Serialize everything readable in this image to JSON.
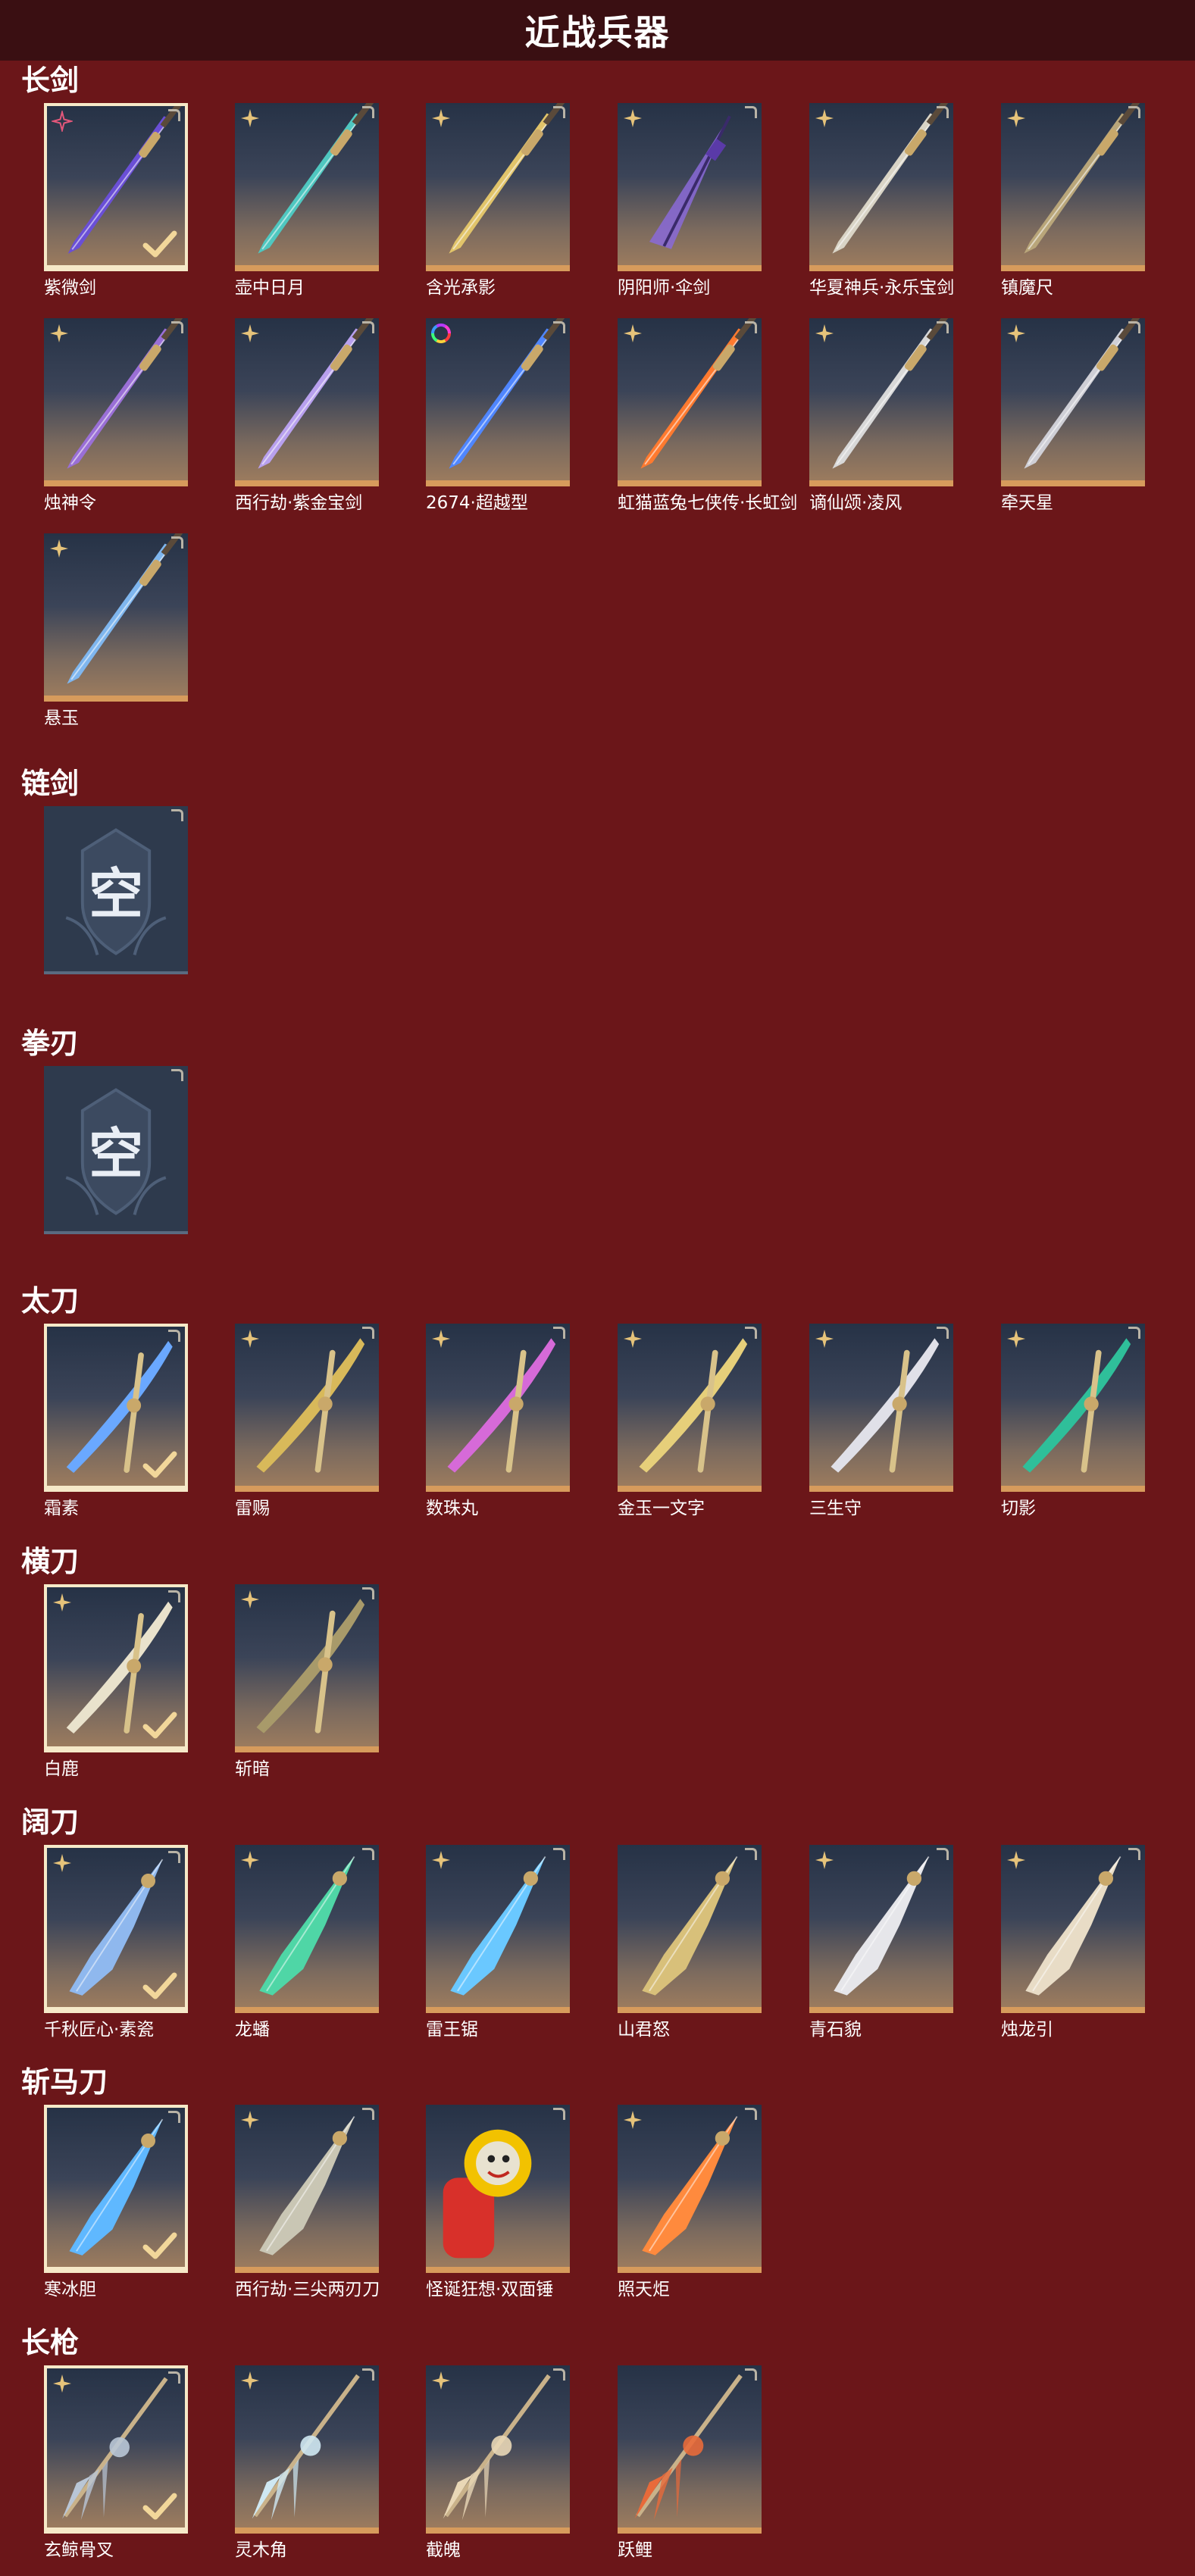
{
  "page": {
    "title": "近战兵器"
  },
  "colors": {
    "background": "#6b1619",
    "header": "#3a0f12",
    "card_accent": "#d79b5c",
    "selected_border": "#f6e9c8",
    "star_badge": "#e6c37a"
  },
  "check_icon": "checkmark-icon",
  "empty_label": "空",
  "sections": [
    {
      "key": "changjian",
      "title": "长剑",
      "items": [
        {
          "label": "紫微剑",
          "selected": true,
          "badge": "pink-star-icon",
          "hue": "#6a4fd6",
          "shape": "sword"
        },
        {
          "label": "壶中日月",
          "selected": false,
          "badge": "gold-star-icon",
          "hue": "#4fc7c0",
          "shape": "sword"
        },
        {
          "label": "含光承影",
          "selected": false,
          "badge": "gold-star-icon",
          "hue": "#e1c46a",
          "shape": "sword"
        },
        {
          "label": "阴阳师·伞剑",
          "selected": false,
          "badge": "gold-star-icon",
          "hue": "#8a6ad8",
          "shape": "umbrella"
        },
        {
          "label": "华夏神兵·永乐宝剑",
          "selected": false,
          "badge": "gold-star-icon",
          "hue": "#d9d4c6",
          "shape": "sword"
        },
        {
          "label": "镇魔尺",
          "selected": false,
          "badge": "gold-star-icon",
          "hue": "#b9a67a",
          "shape": "sword"
        },
        {
          "label": "烛神令",
          "selected": false,
          "badge": "gold-star-icon",
          "hue": "#9a6fd6",
          "shape": "sword"
        },
        {
          "label": "西行劫·紫金宝剑",
          "selected": false,
          "badge": "gold-star-icon",
          "hue": "#b8a0ee",
          "shape": "sword"
        },
        {
          "label": "2674·超越型",
          "selected": false,
          "badge": "rainbow-ring-icon",
          "hue": "#4f86ff",
          "shape": "sword"
        },
        {
          "label": "虹猫蓝兔七侠传·长虹剑",
          "selected": false,
          "badge": "gold-star-icon",
          "hue": "#ff7a2f",
          "shape": "sword"
        },
        {
          "label": "谪仙颂·凌风",
          "selected": false,
          "badge": "gold-star-icon",
          "hue": "#d8d8d8",
          "shape": "sword"
        },
        {
          "label": "牵天星",
          "selected": false,
          "badge": "gold-star-icon",
          "hue": "#cfcfd6",
          "shape": "sword"
        },
        {
          "label": "悬玉",
          "selected": false,
          "badge": "gold-star-icon",
          "hue": "#7fb6ee",
          "shape": "sword",
          "stacked": true
        }
      ]
    },
    {
      "key": "lianjian",
      "title": "链剑",
      "items": [
        {
          "label": "",
          "empty": true
        }
      ]
    },
    {
      "key": "quanren",
      "title": "拳刃",
      "items": [
        {
          "label": "",
          "empty": true
        }
      ]
    },
    {
      "key": "taidao",
      "title": "太刀",
      "items": [
        {
          "label": "霜素",
          "selected": true,
          "badge": "",
          "hue": "#6aa8ff",
          "shape": "blade"
        },
        {
          "label": "雷赐",
          "selected": false,
          "badge": "gold-star-icon",
          "hue": "#d8b95a",
          "shape": "blade"
        },
        {
          "label": "数珠丸",
          "selected": false,
          "badge": "gold-star-icon",
          "hue": "#d66ad8",
          "shape": "blade"
        },
        {
          "label": "金玉一文字",
          "selected": false,
          "badge": "gold-star-icon",
          "hue": "#e6cf7a",
          "shape": "blade"
        },
        {
          "label": "三生守",
          "selected": false,
          "badge": "gold-star-icon",
          "hue": "#e0e0e8",
          "shape": "blade"
        },
        {
          "label": "切影",
          "selected": false,
          "badge": "gold-star-icon",
          "hue": "#2fbf9a",
          "shape": "blade"
        }
      ]
    },
    {
      "key": "hengdao",
      "title": "横刀",
      "items": [
        {
          "label": "白鹿",
          "selected": true,
          "badge": "gold-star-icon",
          "hue": "#e9e2cc",
          "shape": "blade"
        },
        {
          "label": "斩暗",
          "selected": false,
          "badge": "gold-star-icon",
          "hue": "#a89a6a",
          "shape": "blade"
        }
      ]
    },
    {
      "key": "kuodao",
      "title": "阔刀",
      "items": [
        {
          "label": "千秋匠心·素瓷",
          "selected": true,
          "badge": "gold-star-icon",
          "hue": "#8fb8ee",
          "shape": "broad"
        },
        {
          "label": "龙蟠",
          "selected": false,
          "badge": "gold-star-icon",
          "hue": "#4fd6a6",
          "shape": "broad"
        },
        {
          "label": "雷王锯",
          "selected": false,
          "badge": "gold-star-icon",
          "hue": "#6ac8ff",
          "shape": "broad"
        },
        {
          "label": "山君怒",
          "selected": false,
          "badge": "",
          "hue": "#d8c07a",
          "shape": "broad"
        },
        {
          "label": "青石貌",
          "selected": false,
          "badge": "gold-star-icon",
          "hue": "#e6e6ea",
          "shape": "broad"
        },
        {
          "label": "烛龙引",
          "selected": false,
          "badge": "gold-star-icon",
          "hue": "#e8dcc6",
          "shape": "broad"
        }
      ]
    },
    {
      "key": "zhanmadao",
      "title": "斩马刀",
      "items": [
        {
          "label": "寒冰胆",
          "selected": true,
          "badge": "",
          "hue": "#5fb8ff",
          "shape": "broad"
        },
        {
          "label": "西行劫·三尖两刃刀",
          "selected": false,
          "badge": "gold-star-icon",
          "hue": "#c9c6b4",
          "shape": "broad"
        },
        {
          "label": "怪诞狂想·双面锤",
          "selected": false,
          "badge": "",
          "hue": "#f2c200",
          "shape": "hammer"
        },
        {
          "label": "照天炬",
          "selected": false,
          "badge": "gold-star-icon",
          "hue": "#ff8a3d",
          "shape": "broad"
        }
      ]
    },
    {
      "key": "changqiang",
      "title": "长枪",
      "items": [
        {
          "label": "玄鲸骨叉",
          "selected": true,
          "badge": "gold-star-icon",
          "hue": "#b9c6d6",
          "shape": "spear"
        },
        {
          "label": "灵木角",
          "selected": false,
          "badge": "gold-star-icon",
          "hue": "#cfe8f2",
          "shape": "spear"
        },
        {
          "label": "截魄",
          "selected": false,
          "badge": "gold-star-icon",
          "hue": "#e9d7b6",
          "shape": "spear"
        },
        {
          "label": "跃鲤",
          "selected": false,
          "badge": "",
          "hue": "#e86a3a",
          "shape": "spear"
        }
      ]
    }
  ]
}
